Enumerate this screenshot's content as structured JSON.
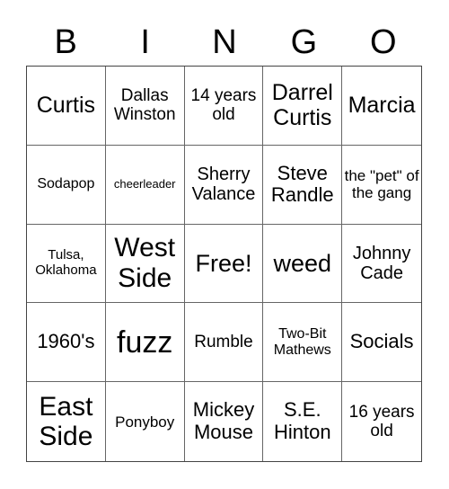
{
  "header": [
    "B",
    "I",
    "N",
    "G",
    "O"
  ],
  "cells": [
    "Curtis",
    "Dallas Winston",
    "14 years old",
    "Darrel Curtis",
    "Marcia",
    "Sodapop",
    "cheerleader",
    "Sherry Valance",
    "Steve Randle",
    "the \"pet\" of the gang",
    "Tulsa, Oklahoma",
    "West Side",
    "Free!",
    "weed",
    "Johnny Cade",
    "1960's",
    "fuzz",
    "Rumble",
    "Two-Bit Mathews",
    "Socials",
    "East Side",
    "Ponyboy",
    "Mickey Mouse",
    "S.E. Hinton",
    "16 years old"
  ]
}
